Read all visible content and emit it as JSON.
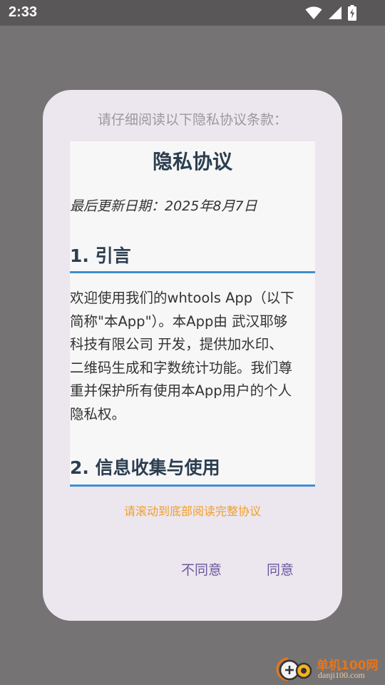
{
  "status_bar": {
    "time": "2:33",
    "icons": [
      "wifi-icon",
      "cell-signal-icon",
      "battery-charging-icon"
    ]
  },
  "dialog": {
    "prompt": "请仔细阅读以下隐私协议条款：",
    "document": {
      "title": "隐私协议",
      "last_updated": "最后更新日期：2025年8月7日",
      "sections": [
        {
          "heading": "1. 引言",
          "body": "欢迎使用我们的whtools App（以下\n简称\"本App\"）。本App由 武汉耶够\n科技有限公司 开发，提供加水印、\n二维码生成和字数统计功能。我们尊\n重并保护所有使用本App用户的个人\n隐私权。"
        },
        {
          "heading": "2. 信息收集与使用"
        }
      ]
    },
    "scroll_hint": "请滚动到底部阅读完整协议",
    "buttons": {
      "disagree": "不同意",
      "agree": "同意"
    }
  },
  "watermark": {
    "site_name": "单机100网",
    "site_url": "danji100.com"
  },
  "colors": {
    "accent_blue": "#3f8fd0",
    "hint_orange": "#ef9f2b",
    "button_purple": "#6a5a9c",
    "heading_navy": "#2c3e50"
  }
}
